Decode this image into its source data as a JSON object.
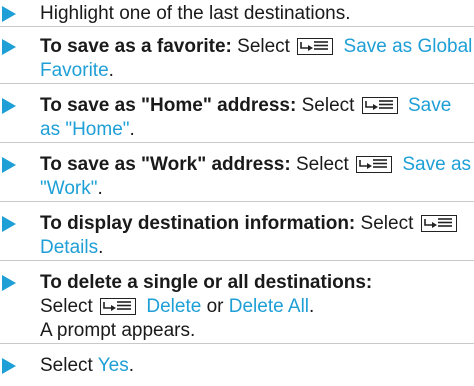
{
  "steps": [
    {
      "text": "Highlight one of the last destinations."
    },
    {
      "bold": "To save as a favorite:",
      "select": "Select",
      "link": "Save as Global Favorite",
      "end": "."
    },
    {
      "bold": "To save as \"Home\" address:",
      "select": "Select",
      "link": "Save as \"Home\"",
      "end": "."
    },
    {
      "bold": "To save as \"Work\" address:",
      "select": "Select",
      "link": "Save as \"Work\"",
      "end": "."
    },
    {
      "bold": "To display destination information:",
      "select": "Select",
      "link": "Details",
      "end": "."
    },
    {
      "bold": "To delete a single or all destinations:",
      "select": "Select",
      "link": "Delete",
      "or": "or",
      "link2": "Delete All",
      "end": ".",
      "note": "A prompt appears."
    },
    {
      "select": "Select",
      "link": "Yes",
      "end": "."
    }
  ],
  "icons": {
    "bullet": "triangle-right-icon",
    "menu": "menu-button-icon"
  },
  "colors": {
    "accent": "#1e9fd6",
    "text": "#1a1a1a",
    "divider": "#c9c9c9"
  }
}
